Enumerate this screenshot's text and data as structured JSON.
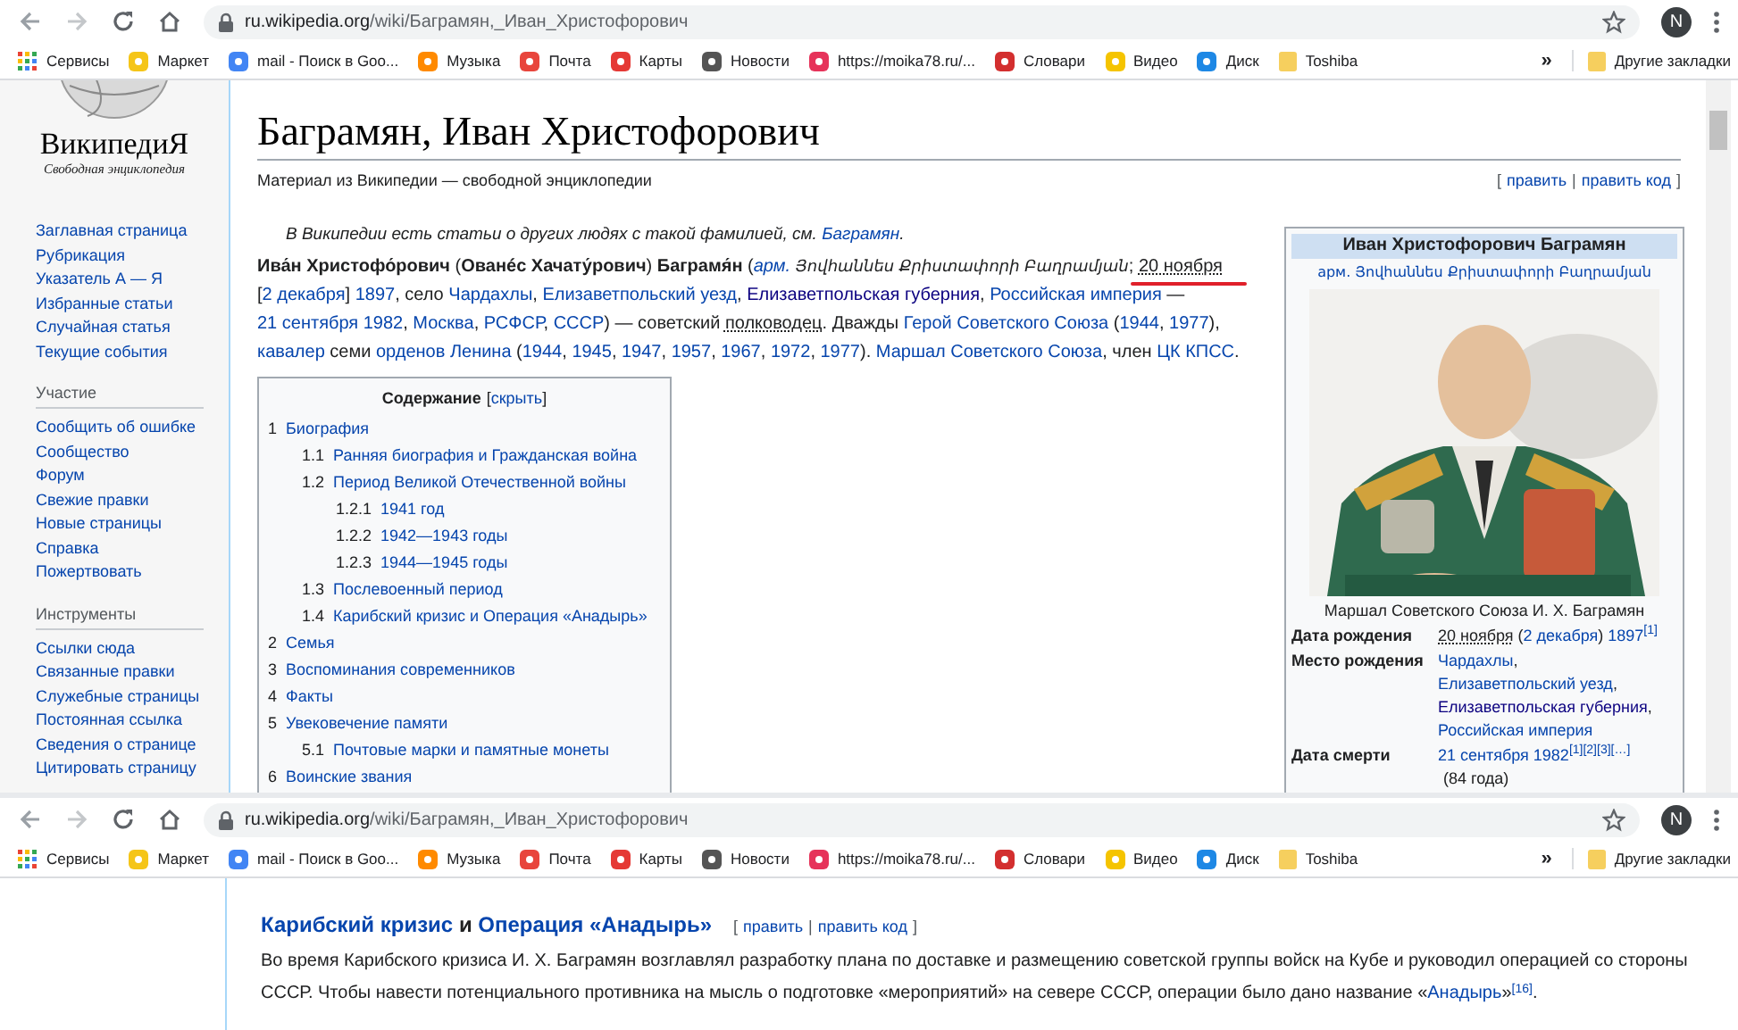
{
  "windows": [
    {
      "url_host": "ru.wikipedia.org",
      "url_path": "/wiki/Баграмян,_Иван_Христофорович",
      "avatar": "N",
      "bookmarks_overflow": "»",
      "bookmarks": [
        {
          "label": "Сервисы",
          "kind": "apps"
        },
        {
          "label": "Маркет",
          "kind": "site",
          "color": "#f5c518"
        },
        {
          "label": "mail - Поиск в Goo...",
          "kind": "site",
          "color": "#4285f4"
        },
        {
          "label": "Музыка",
          "kind": "site",
          "color": "#ff8a00"
        },
        {
          "label": "Почта",
          "kind": "site",
          "color": "#e8453c"
        },
        {
          "label": "Карты",
          "kind": "site",
          "color": "#e53935"
        },
        {
          "label": "Новости",
          "kind": "site",
          "color": "#555555"
        },
        {
          "label": "https://moika78.ru/...",
          "kind": "site",
          "color": "#e6335a"
        },
        {
          "label": "Словари",
          "kind": "site",
          "color": "#d32f2f"
        },
        {
          "label": "Видео",
          "kind": "site",
          "color": "#f5c400"
        },
        {
          "label": "Диск",
          "kind": "site",
          "color": "#1e88e5"
        },
        {
          "label": "Toshiba",
          "kind": "folder"
        }
      ],
      "other_bookmarks": "Другие закладки"
    },
    {
      "url_host": "ru.wikipedia.org",
      "url_path": "/wiki/Баграмян,_Иван_Христофорович",
      "avatar": "N",
      "bookmarks_overflow": "»",
      "bookmarks": [
        {
          "label": "Сервисы",
          "kind": "apps"
        },
        {
          "label": "Маркет",
          "kind": "site",
          "color": "#f5c518"
        },
        {
          "label": "mail - Поиск в Goo...",
          "kind": "site",
          "color": "#4285f4"
        },
        {
          "label": "Музыка",
          "kind": "site",
          "color": "#ff8a00"
        },
        {
          "label": "Почта",
          "kind": "site",
          "color": "#e8453c"
        },
        {
          "label": "Карты",
          "kind": "site",
          "color": "#e53935"
        },
        {
          "label": "Новости",
          "kind": "site",
          "color": "#555555"
        },
        {
          "label": "https://moika78.ru/...",
          "kind": "site",
          "color": "#e6335a"
        },
        {
          "label": "Словари",
          "kind": "site",
          "color": "#d32f2f"
        },
        {
          "label": "Видео",
          "kind": "site",
          "color": "#f5c400"
        },
        {
          "label": "Диск",
          "kind": "site",
          "color": "#1e88e5"
        },
        {
          "label": "Toshiba",
          "kind": "folder"
        }
      ],
      "other_bookmarks": "Другие закладки"
    }
  ],
  "sidebar": {
    "logo_title": "ВикипедиЯ",
    "logo_tagline": "Свободная энциклопедия",
    "groups": [
      {
        "items": [
          "Заглавная страница",
          "Рубрикация",
          "Указатель А — Я",
          "Избранные статьи",
          "Случайная статья",
          "Текущие события"
        ]
      },
      {
        "heading": "Участие",
        "items": [
          "Сообщить об ошибке",
          "Сообщество",
          "Форум",
          "Свежие правки",
          "Новые страницы",
          "Справка",
          "Пожертвовать"
        ]
      },
      {
        "heading": "Инструменты",
        "items": [
          "Ссылки сюда",
          "Связанные правки",
          "Служебные страницы",
          "Постоянная ссылка",
          "Сведения о странице",
          "Цитировать страницу"
        ]
      }
    ]
  },
  "article": {
    "title": "Баграмян, Иван Христофорович",
    "subtitle": "Материал из Википедии — свободной энциклопедии",
    "edit_links": {
      "open": "[",
      "items": [
        "править",
        "править код"
      ],
      "separator": "|",
      "close": "]"
    },
    "hatnote": [
      {
        "kind": "plain",
        "text": "В Википедии есть статьи о других людях с такой фамилией, см. "
      },
      {
        "kind": "link",
        "text": "Баграмян"
      },
      {
        "kind": "plain",
        "text": "."
      }
    ],
    "lead": [
      {
        "kind": "bold",
        "text": "Ива́н Христофо́рович"
      },
      {
        "kind": "plain",
        "text": " ("
      },
      {
        "kind": "bold",
        "text": "Ованéс Хачату́рович"
      },
      {
        "kind": "plain",
        "text": ") "
      },
      {
        "kind": "bold",
        "text": "Баграмя́н"
      },
      {
        "kind": "plain",
        "text": " ("
      },
      {
        "kind": "italic_link",
        "text": "арм."
      },
      {
        "kind": "armenian",
        "text": " Յովհաննես Քրիստափորի Բաղրամյան"
      },
      {
        "kind": "plain",
        "text": "; "
      },
      {
        "kind": "date",
        "text": "20 ноября",
        "marked": true
      },
      {
        "kind": "plain",
        "text": " ["
      },
      {
        "kind": "link",
        "text": "2 декабря"
      },
      {
        "kind": "plain",
        "text": "] "
      },
      {
        "kind": "link",
        "text": "1897"
      },
      {
        "kind": "plain",
        "text": ", село "
      },
      {
        "kind": "link",
        "text": "Чардахлы"
      },
      {
        "kind": "plain",
        "text": ", "
      },
      {
        "kind": "link",
        "text": "Елизаветпольский уезд"
      },
      {
        "kind": "plain",
        "text": ", "
      },
      {
        "kind": "visited",
        "text": "Елизаветпольская губерния"
      },
      {
        "kind": "plain",
        "text": ", "
      },
      {
        "kind": "link",
        "text": "Российская империя"
      },
      {
        "kind": "plain",
        "text": " — "
      },
      {
        "kind": "link",
        "text": "21 сентября 1982"
      },
      {
        "kind": "plain",
        "text": ", "
      },
      {
        "kind": "link",
        "text": "Москва"
      },
      {
        "kind": "plain",
        "text": ", "
      },
      {
        "kind": "link",
        "text": "РСФСР"
      },
      {
        "kind": "plain",
        "text": ", "
      },
      {
        "kind": "link",
        "text": "СССР"
      },
      {
        "kind": "plain",
        "text": ") — советский "
      },
      {
        "kind": "date",
        "text": "полководец"
      },
      {
        "kind": "plain",
        "text": ". Дважды "
      },
      {
        "kind": "link",
        "text": "Герой Советского Союза"
      },
      {
        "kind": "plain",
        "text": " ("
      },
      {
        "kind": "link",
        "text": "1944"
      },
      {
        "kind": "plain",
        "text": ", "
      },
      {
        "kind": "link",
        "text": "1977"
      },
      {
        "kind": "plain",
        "text": "), "
      },
      {
        "kind": "link",
        "text": "кавалер"
      },
      {
        "kind": "plain",
        "text": " семи "
      },
      {
        "kind": "link",
        "text": "орденов Ленина"
      },
      {
        "kind": "plain",
        "text": " ("
      },
      {
        "kind": "link",
        "text": "1944"
      },
      {
        "kind": "plain",
        "text": ", "
      },
      {
        "kind": "link",
        "text": "1945"
      },
      {
        "kind": "plain",
        "text": ", "
      },
      {
        "kind": "link",
        "text": "1947"
      },
      {
        "kind": "plain",
        "text": ", "
      },
      {
        "kind": "link",
        "text": "1957"
      },
      {
        "kind": "plain",
        "text": ", "
      },
      {
        "kind": "link",
        "text": "1967"
      },
      {
        "kind": "plain",
        "text": ", "
      },
      {
        "kind": "link",
        "text": "1972"
      },
      {
        "kind": "plain",
        "text": ", "
      },
      {
        "kind": "link",
        "text": "1977"
      },
      {
        "kind": "plain",
        "text": "). "
      },
      {
        "kind": "link",
        "text": "Маршал Советского Союза"
      },
      {
        "kind": "plain",
        "text": ", член "
      },
      {
        "kind": "link",
        "text": "ЦК КПСС"
      },
      {
        "kind": "plain",
        "text": "."
      }
    ],
    "toc": {
      "heading": "Содержание",
      "toggle_open": "[",
      "toggle": "скрыть",
      "toggle_close": "]",
      "entries": [
        {
          "num": "1",
          "title": "Биография",
          "children": [
            {
              "num": "1.1",
              "title": "Ранняя биография и Гражданская война"
            },
            {
              "num": "1.2",
              "title": "Период Великой Отечественной войны",
              "children": [
                {
                  "num": "1.2.1",
                  "title": "1941 год"
                },
                {
                  "num": "1.2.2",
                  "title": "1942—1943 годы"
                },
                {
                  "num": "1.2.3",
                  "title": "1944—1945 годы"
                }
              ]
            },
            {
              "num": "1.3",
              "title": "Послевоенный период"
            },
            {
              "num": "1.4",
              "title": "Карибский кризис и Операция «Анадырь»"
            }
          ]
        },
        {
          "num": "2",
          "title": "Семья"
        },
        {
          "num": "3",
          "title": "Воспоминания современников"
        },
        {
          "num": "4",
          "title": "Факты"
        },
        {
          "num": "5",
          "title": "Увековечение памяти",
          "children": [
            {
              "num": "5.1",
              "title": "Почтовые марки и памятные монеты"
            }
          ]
        },
        {
          "num": "6",
          "title": "Воинские звания"
        }
      ]
    },
    "infobox": {
      "title": "Иван Христофорович Баграмян",
      "native_name": [
        {
          "kind": "armenian_link",
          "text": "арм. Յովհաննես Քրիստափորի Բաղրամյան"
        }
      ],
      "caption": "Маршал Советского Союза И. Х. Баграмян",
      "rows": [
        {
          "label": "Дата рождения",
          "value": [
            {
              "kind": "date",
              "text": "20 ноября"
            },
            {
              "kind": "plain",
              "text": " ("
            },
            {
              "kind": "link",
              "text": "2 декабря"
            },
            {
              "kind": "plain",
              "text": ") "
            },
            {
              "kind": "link",
              "text": "1897"
            },
            {
              "kind": "ref",
              "text": "[1]"
            }
          ]
        },
        {
          "label": "Место рождения",
          "value": [
            {
              "kind": "link",
              "text": "Чардахлы"
            },
            {
              "kind": "plain",
              "text": ", "
            },
            {
              "kind": "link",
              "text": "Елизаветпольский уезд"
            },
            {
              "kind": "plain",
              "text": ", "
            },
            {
              "kind": "visited",
              "text": "Елизаветпольская губерния"
            },
            {
              "kind": "plain",
              "text": ", "
            },
            {
              "kind": "link",
              "text": "Российская империя"
            }
          ]
        },
        {
          "label": "Дата смерти",
          "value": [
            {
              "kind": "link",
              "text": "21 сентября 1982"
            },
            {
              "kind": "ref",
              "text": "[1][2][3][…]"
            },
            {
              "kind": "note",
              "text": "(84 года)"
            }
          ]
        }
      ]
    }
  },
  "section": {
    "heading": [
      {
        "kind": "link",
        "text": "Карибский кризис"
      },
      {
        "kind": "plain",
        "text": " и "
      },
      {
        "kind": "link",
        "text": "Операция «Анадырь»"
      }
    ],
    "edit_links": {
      "open": "[",
      "items": [
        "править",
        "править код"
      ],
      "separator": "|",
      "close": "]"
    },
    "paragraph": [
      {
        "kind": "plain",
        "text": "Во время Карибского кризиса И. Х. Баграмян возглавлял разработку плана по доставке и размещению советской группы войск на Кубе и руководил операцией со стороны СССР. Чтобы навести потенциального противника на мысль о подготовке «мероприятий» на севере СССР, операции было дано название «"
      },
      {
        "kind": "link",
        "text": "Анадырь"
      },
      {
        "kind": "plain",
        "text": "»"
      },
      {
        "kind": "ref",
        "text": "[16]"
      },
      {
        "kind": "plain",
        "text": "."
      }
    ]
  }
}
